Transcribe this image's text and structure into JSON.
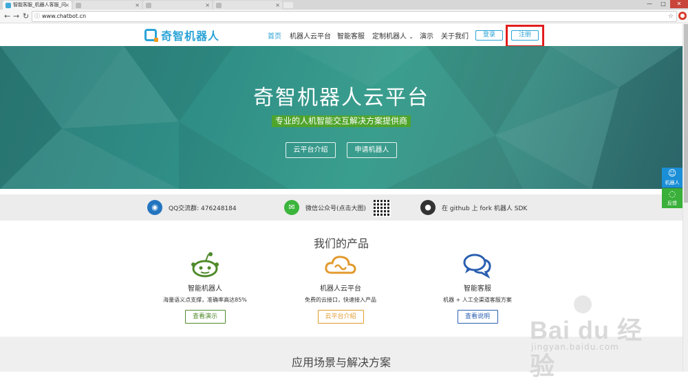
{
  "browser": {
    "tabs": [
      {
        "title": "智能客服_机器人客服_问",
        "active": true
      },
      {
        "title": "",
        "active": false
      },
      {
        "title": "",
        "active": false
      },
      {
        "title": "",
        "active": false
      }
    ],
    "url": "www.chatbot.cn",
    "window_buttons": [
      "—",
      "□",
      "✕"
    ]
  },
  "site": {
    "logo_text": "奇智机器人",
    "nav": [
      "首页",
      "机器人云平台",
      "智能客服",
      "定制机器人",
      "演示",
      "关于我们"
    ],
    "login": "登录",
    "register": "注册"
  },
  "hero": {
    "title": "奇智机器人云平台",
    "subtitle": "专业的人机智能交互解决方案提供商",
    "btn1": "云平台介绍",
    "btn2": "申请机器人"
  },
  "strip": {
    "qq": "QQ交流群: 476248184",
    "wechat": "微信公众号(点击大图)",
    "github": "在 github 上 fork 机器人 SDK"
  },
  "products": {
    "title": "我们的产品",
    "items": [
      {
        "name": "智能机器人",
        "desc": "海量语义点支撑，准确率高达85%",
        "btn": "查看演示",
        "color": "#4f8a2b"
      },
      {
        "name": "机器人云平台",
        "desc": "免费的云接口，快速接入产品",
        "btn": "云平台介绍",
        "color": "#e29a2e"
      },
      {
        "name": "智能客服",
        "desc": "机器 + 人工全渠道客服方案",
        "btn": "查看说明",
        "color": "#2a5fb0"
      }
    ]
  },
  "section2_title": "应用场景与解决方案",
  "float": {
    "robot": "机器人",
    "feedback": "反馈"
  },
  "watermark": {
    "text": "Bai du 经验",
    "url": "jingyan.baidu.com"
  }
}
